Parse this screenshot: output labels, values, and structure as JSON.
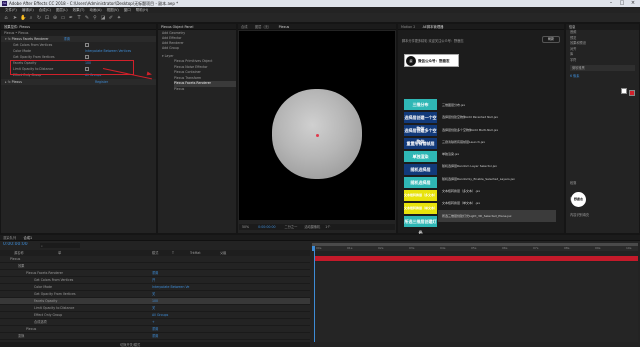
{
  "titlebar": {
    "title": "Adobe After Effects CC 2018 - C:\\Users\\Administrator\\Desktop\\无标题项目 - 副本.aep *"
  },
  "menu": [
    "文件(F)",
    "编辑(E)",
    "合成(C)",
    "图层(L)",
    "效果(T)",
    "动画(A)",
    "视图(V)",
    "窗口",
    "帮助(H)"
  ],
  "effect_controls": {
    "tab": "效果控件: Plexus",
    "layer_row": "Plexus • Plexus",
    "effect_name": "Plexus Facets Renderer",
    "reset": "重置",
    "props": [
      {
        "label": "Get Colors From Vertices",
        "value": ""
      },
      {
        "label": "Color Mode",
        "value": "Interpolate Between Vertices"
      },
      {
        "label": "Get Opacity From Vertices",
        "value": ""
      },
      {
        "label": "Facets Opacity",
        "value": "100"
      },
      {
        "label": "Limit Opacity to Distance",
        "value": ""
      },
      {
        "label": "Effect Only Group",
        "value": "All Groups"
      }
    ],
    "plexus_row": "Plexus",
    "plexus_right": "Register"
  },
  "object_panel": {
    "title": "Plexus Object Panel",
    "actions": [
      "Add Geometry",
      "Add Effector",
      "Add Renderer",
      "Add Group"
    ],
    "tree_header": "Layer",
    "tree": [
      "Plexus Primitives Object",
      "Plexus Noise Effector",
      "Plexus Container",
      "Plexus Transform",
      "Plexus Facets Renderer",
      "Plexus"
    ]
  },
  "viewer": {
    "tabs": [
      "合成",
      "图层（无）",
      "Plexus"
    ],
    "zoom": "50%",
    "timecode": "0:00:00:00",
    "quality": "二分之一",
    "camera": "活动摄像机",
    "views": "1个"
  },
  "motion_panel": {
    "tabs": [
      "Motion 2",
      "AE脚本管理器"
    ],
    "header_text": "脚本分享更多精彩 欢迎关注公众号：野鹿志",
    "refresh_btn": "刷新",
    "wechat_banner": "微信公众号：野鹿志",
    "left_buttons": [
      {
        "label": "三维分布",
        "style": "cyanbtn"
      },
      {
        "label": "选择层创建一个空物体",
        "style": "navybtn"
      },
      {
        "label": "选择层创建多个空物体",
        "style": "navybtn"
      },
      {
        "label": "重置所有错帧层",
        "style": "navybtn"
      },
      {
        "label": "单独渲染",
        "style": "cyanbtn"
      },
      {
        "label": "随机选择层",
        "style": "navybtn"
      },
      {
        "label": "随机选择层",
        "style": "cyanbtn"
      },
      {
        "label": "文本框转换层（多文本）",
        "style": "yellowbtn"
      },
      {
        "label": "文本框转换层（单文本）",
        "style": "yellowbtn"
      },
      {
        "label": "所选三维层创建灯光",
        "style": "cyanbtn"
      }
    ],
    "scripts": [
      "三维图层分布.jsx",
      "选择层创建空物体Add Parented Null.jsx",
      "选择层创建多个空物体Add Multi-Null.jsx",
      "三键清除所有错帧层Launch.jsx",
      "单独渲染.jsx",
      "随机选择层Random Layer Selector.jsx",
      "随机选择层Randomly_Enable_Selected_Layers.jsx",
      "文本框转换层（多文本）.jsx",
      "文本框转换层（单文本）.jsx",
      "所选三维层创建灯光Light_3D_Selected_Plane.jsx"
    ],
    "footer_left": "打开文件",
    "footer_right": "运行"
  },
  "right_panel": {
    "title": "信息",
    "items": [
      "音频",
      "预览",
      "效果和预设",
      "对齐",
      "库",
      "字符"
    ],
    "font": "微软雅黑",
    "size": "6 像素",
    "extra_items": [
      "段落",
      "跟踪器",
      "内容识别填充"
    ],
    "logo_text": "野鹿志"
  },
  "timeline": {
    "tabs": [
      "渲染队列",
      "合成1"
    ],
    "timecode": "0:00:00:00",
    "columns": [
      "源名称",
      "单",
      "模式",
      "T",
      "TrkMat",
      "父级"
    ],
    "rows": [
      {
        "label": "Plexus",
        "indent": 0,
        "value": ""
      },
      {
        "label": "效果",
        "indent": 1,
        "value": ""
      },
      {
        "label": "Plexus Facets Renderer",
        "indent": 2,
        "value": "重置"
      },
      {
        "label": "Get Colors From Vertices",
        "indent": 3,
        "value": "开"
      },
      {
        "label": "Color Mode",
        "indent": 3,
        "value": "Interpolate Between Ve"
      },
      {
        "label": "Get Opacity From Vertices",
        "indent": 3,
        "value": "关"
      },
      {
        "label": "Facets Opacity",
        "indent": 3,
        "value": "100"
      },
      {
        "label": "Limit Opacity to Distance",
        "indent": 3,
        "value": "关"
      },
      {
        "label": "Effect Only Group",
        "indent": 3,
        "value": "All Groups"
      },
      {
        "label": "合成选项",
        "indent": 3,
        "value": "+"
      },
      {
        "label": "Plexus",
        "indent": 2,
        "value": "重置"
      },
      {
        "label": "变换",
        "indent": 1,
        "value": "重置"
      }
    ],
    "bottom_label": "切换开关/模式",
    "ruler_marks": [
      "00s",
      "01s",
      "02s",
      "03s",
      "04s",
      "05s",
      "06s",
      "07s",
      "08s",
      "09s",
      "10s"
    ]
  }
}
